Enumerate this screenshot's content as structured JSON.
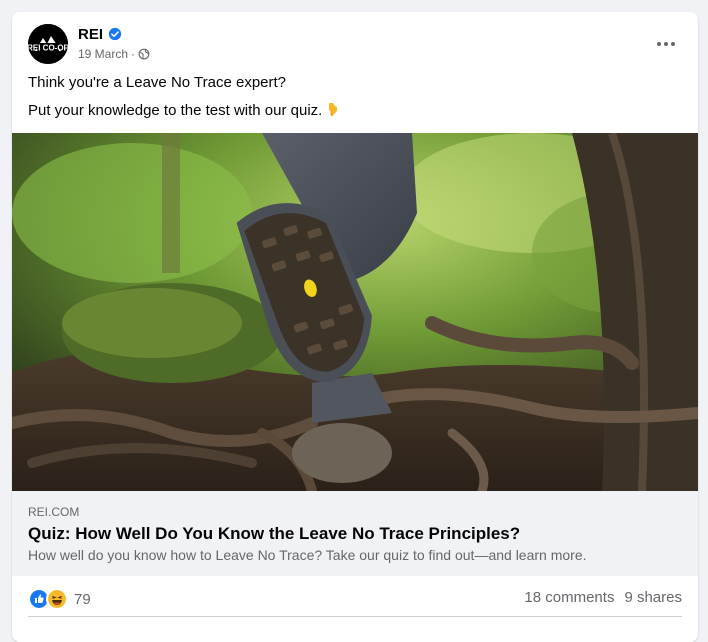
{
  "post": {
    "author": "REI",
    "date": "19 March",
    "separator": "·",
    "text_line1": "Think you're a Leave No Trace expert?",
    "text_line2": "Put your knowledge to the test with our quiz.",
    "image_alt": "hiking boot stepping over tree roots",
    "avatar_logo": "REI CO-OP"
  },
  "link": {
    "domain": "REI.COM",
    "title": "Quiz: How Well Do You Know the Leave No Trace Principles?",
    "description": "How well do you know how to Leave No Trace? Take our quiz to find out—and learn more."
  },
  "stats": {
    "reaction_count": "79",
    "comments": "18 comments",
    "shares": "9 shares"
  },
  "icons": {
    "verified": "verified-badge-icon",
    "privacy": "globe-icon",
    "more": "more-options-icon",
    "emoji": "backhand-index-pointing-down",
    "like": "like-reaction-icon",
    "haha": "haha-reaction-icon"
  },
  "colors": {
    "brand_blue": "#1877f2",
    "text_secondary": "#65676b",
    "link_bg": "#f0f2f5"
  }
}
